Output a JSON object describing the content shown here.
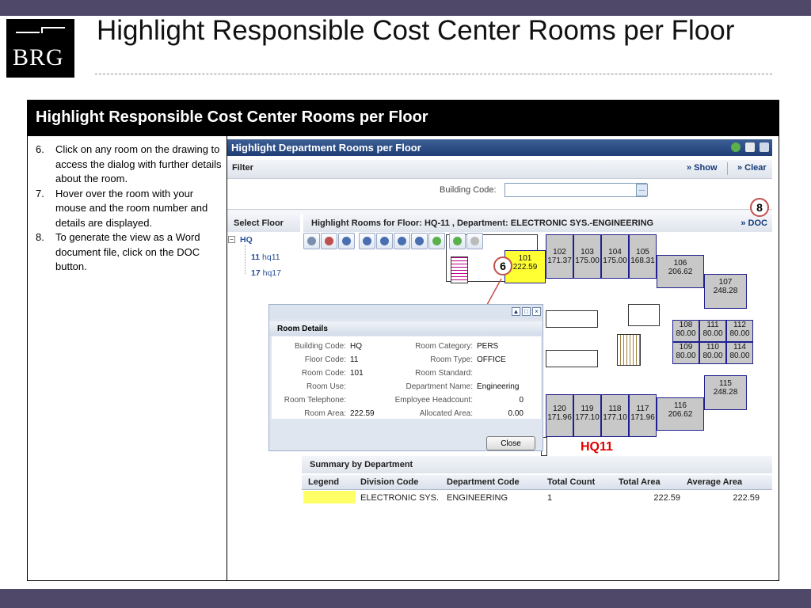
{
  "slide": {
    "title": "Highlight Responsible Cost Center Rooms per Floor",
    "logo_text": "BRG"
  },
  "table": {
    "header": "Highlight Responsible Cost Center Rooms per Floor",
    "steps": [
      {
        "num": "6.",
        "text": "Click on any room on the drawing to access  the dialog with further details about the room."
      },
      {
        "num": "7.",
        "text": "Hover over the room with your mouse and the room number and details are displayed."
      },
      {
        "num": "8.",
        "text": "To generate the view as a Word document file, click on the DOC button."
      }
    ]
  },
  "app": {
    "title": "Highlight Department Rooms per Floor",
    "filter_label": "Filter",
    "show_label": "» Show",
    "clear_label": "» Clear",
    "building_code_label": "Building Code:",
    "building_code_value": "",
    "building_code_btn": "...",
    "select_floor_label": "Select Floor",
    "drawing_header": "Highlight Rooms for Floor: HQ-11 , Department: ELECTRONIC SYS.-ENGINEERING",
    "doc_label": "» DOC",
    "tree": {
      "root": "HQ",
      "floors": [
        {
          "code": "11",
          "name": "hq11"
        },
        {
          "code": "17",
          "name": "hq17"
        }
      ]
    },
    "toolbar_icons": [
      "select-icon",
      "select-window-icon",
      "zoom-window-icon",
      "zoom-in-icon",
      "zoom-out-icon",
      "zoom-extents-icon",
      "zoom-selected-icon",
      "layers-icon",
      "pan-icon",
      "clear-icon"
    ],
    "rooms": [
      {
        "id": "101",
        "area": "222.59",
        "highlight": true
      },
      {
        "id": "102",
        "area": "171.37"
      },
      {
        "id": "103",
        "area": "175.00"
      },
      {
        "id": "104",
        "area": "175.00"
      },
      {
        "id": "105",
        "area": "168.31"
      },
      {
        "id": "106",
        "area": "206.62"
      },
      {
        "id": "107",
        "area": "248.28"
      },
      {
        "id": "108",
        "area": "80.00"
      },
      {
        "id": "111",
        "area": "80.00"
      },
      {
        "id": "112",
        "area": "80.00"
      },
      {
        "id": "109",
        "area": "80.00"
      },
      {
        "id": "110",
        "area": "80.00"
      },
      {
        "id": "114",
        "area": "80.00"
      },
      {
        "id": "115",
        "area": "248.28"
      },
      {
        "id": "116",
        "area": "206.62"
      },
      {
        "id": "117",
        "area": "171.96"
      },
      {
        "id": "118",
        "area": "177.10"
      },
      {
        "id": "119",
        "area": "177.10"
      },
      {
        "id": "120",
        "area": "171.96"
      }
    ],
    "floor_label": "HQ11",
    "callouts": {
      "six": "6",
      "eight": "8"
    },
    "dialog": {
      "title": "Room Details",
      "left": [
        {
          "label": "Building Code:",
          "value": "HQ"
        },
        {
          "label": "Floor Code:",
          "value": "11"
        },
        {
          "label": "Room Code:",
          "value": "101"
        },
        {
          "label": "Room Use:",
          "value": ""
        },
        {
          "label": "Room Telephone:",
          "value": ""
        },
        {
          "label": "Room Area:",
          "value": "222.59"
        }
      ],
      "right": [
        {
          "label": "Room Category:",
          "value": "PERS"
        },
        {
          "label": "Room Type:",
          "value": "OFFICE"
        },
        {
          "label": "Room Standard:",
          "value": ""
        },
        {
          "label": "Department Name:",
          "value": "Engineering"
        },
        {
          "label": "Employee Headcount:",
          "value": "0"
        },
        {
          "label": "Allocated Area:",
          "value": "0.00"
        }
      ],
      "close_label": "Close"
    },
    "summary": {
      "title": "Summary by Department",
      "columns": [
        "Legend",
        "Division Code",
        "Department Code",
        "Total Count",
        "Total Area",
        "Average Area"
      ],
      "rows": [
        {
          "legend_color": "#ffff66",
          "division": "ELECTRONIC SYS.",
          "department": "ENGINEERING",
          "count": "1",
          "total_area": "222.59",
          "average_area": "222.59"
        }
      ]
    }
  }
}
